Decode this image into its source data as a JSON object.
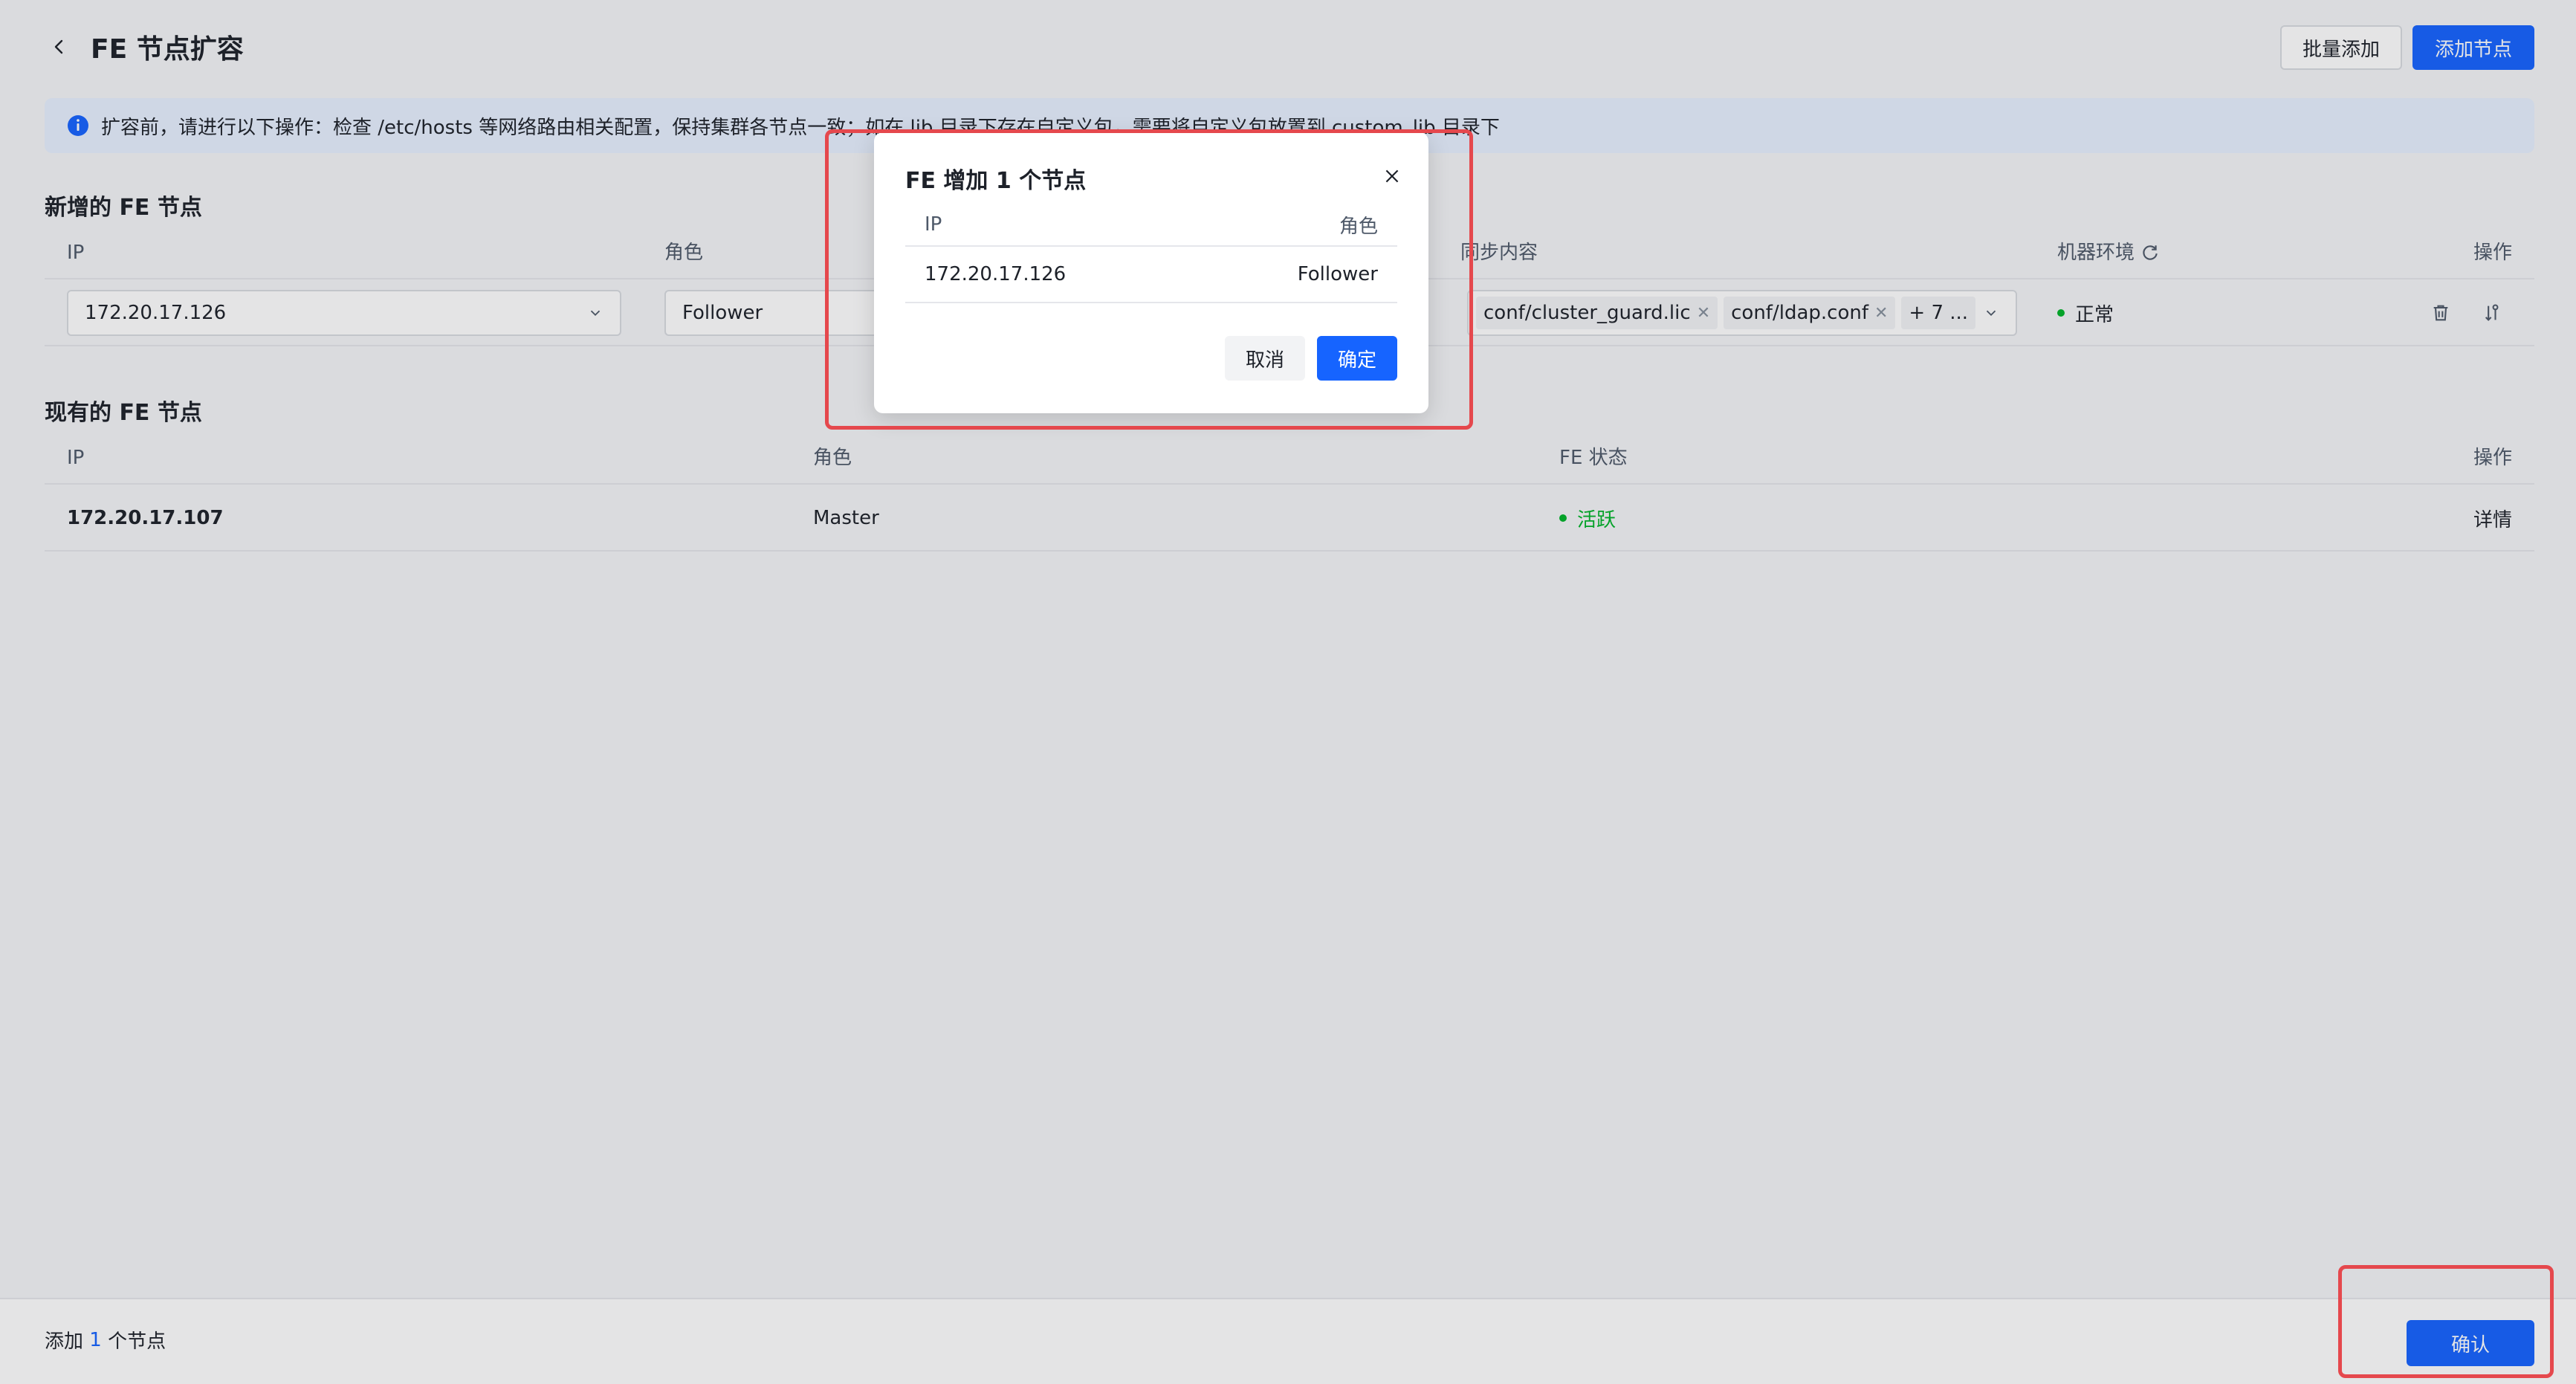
{
  "header": {
    "title": "FE 节点扩容",
    "batch_add_label": "批量添加",
    "add_node_label": "添加节点"
  },
  "alert": {
    "text": "扩容前，请进行以下操作：检查 /etc/hosts 等网络路由相关配置，保持集群各节点一致；如在 lib 目录下存在自定义包，需要将自定义包放置到 custom_lib 目录下"
  },
  "new_section": {
    "title": "新增的 FE 节点",
    "columns": {
      "ip": "IP",
      "role": "角色",
      "sync": "同步内容",
      "env": "机器环境",
      "ops": "操作"
    },
    "row": {
      "ip": "172.20.17.126",
      "role": "Follower",
      "tags": [
        "conf/cluster_guard.lic",
        "conf/ldap.conf"
      ],
      "more_tag": "+ 7 ...",
      "env_status": "正常"
    }
  },
  "existing_section": {
    "title": "现有的 FE 节点",
    "columns": {
      "ip": "IP",
      "role": "角色",
      "status": "FE 状态",
      "ops": "操作"
    },
    "rows": [
      {
        "ip": "172.20.17.107",
        "role": "Master",
        "status": "活跃",
        "detail": "详情"
      }
    ]
  },
  "footer": {
    "prefix": "添加 ",
    "count": "1",
    "suffix": " 个节点",
    "confirm_label": "确认"
  },
  "modal": {
    "title": "FE 增加 1 个节点",
    "col_ip": "IP",
    "col_role": "角色",
    "rows": [
      {
        "ip": "172.20.17.126",
        "role": "Follower"
      }
    ],
    "cancel_label": "取消",
    "ok_label": "确定"
  },
  "colors": {
    "primary": "#1664ff",
    "success": "#00b42a",
    "highlight": "#e5484d",
    "alert_bg": "#e8f1ff"
  }
}
